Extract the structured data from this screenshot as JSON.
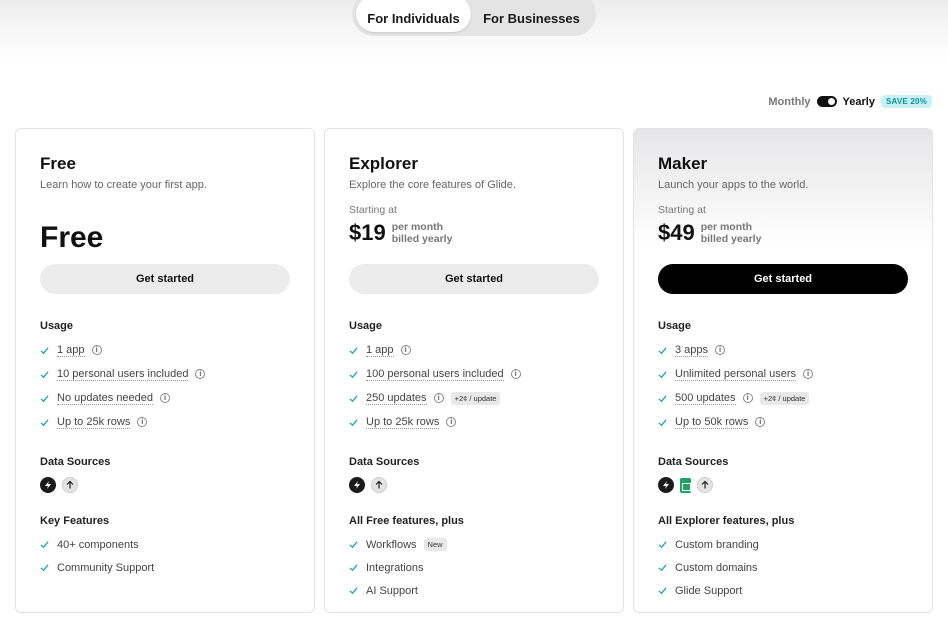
{
  "audience_tabs": [
    {
      "label": "For Individuals",
      "active": true
    },
    {
      "label": "For Businesses",
      "active": false
    }
  ],
  "billing": {
    "monthly_label": "Monthly",
    "yearly_label": "Yearly",
    "selected": "Yearly",
    "save_badge": "SAVE 20%"
  },
  "colors": {
    "accent": "#17a7b5",
    "badge_bg": "#c8f1f4",
    "dark_button": "#000000"
  },
  "plans": [
    {
      "name": "Free",
      "description": "Learn how to create your first app.",
      "price_display": "Free",
      "cta": "Get started",
      "usage_title": "Usage",
      "usage": [
        {
          "text": "1 app",
          "info": true
        },
        {
          "text": "10 personal users included",
          "info": true
        },
        {
          "text": "No updates needed",
          "info": true
        },
        {
          "text": "Up to 25k rows",
          "info": true
        }
      ],
      "sources_title": "Data Sources",
      "sources": [
        "glide-icon",
        "upload-icon"
      ],
      "features_title": "Key Features",
      "features": [
        "40+ components",
        "Community Support"
      ]
    },
    {
      "name": "Explorer",
      "description": "Explore the core features of Glide.",
      "starting_label": "Starting at",
      "price": "$19",
      "period_line1": "per month",
      "period_line2": "billed yearly",
      "cta": "Get started",
      "usage_title": "Usage",
      "usage": [
        {
          "text": "1 app",
          "info": true
        },
        {
          "text": "100 personal users included",
          "info": true
        },
        {
          "text": "250 updates",
          "info": true,
          "tag": "+2¢ / update"
        },
        {
          "text": "Up to 25k rows",
          "info": true
        }
      ],
      "sources_title": "Data Sources",
      "sources": [
        "glide-icon",
        "upload-icon"
      ],
      "features_title": "All Free features, plus",
      "features": [
        {
          "text": "Workflows",
          "tag": "New"
        },
        {
          "text": "Integrations"
        },
        {
          "text": "AI Support"
        }
      ]
    },
    {
      "name": "Maker",
      "description": "Launch your apps to the world.",
      "starting_label": "Starting at",
      "price": "$49",
      "period_line1": "per month",
      "period_line2": "billed yearly",
      "cta": "Get started",
      "usage_title": "Usage",
      "usage": [
        {
          "text": "3 apps",
          "info": true
        },
        {
          "text": "Unlimited personal users",
          "info": true
        },
        {
          "text": "500 updates",
          "info": true,
          "tag": "+2¢ / update"
        },
        {
          "text": "Up to 50k rows",
          "info": true
        }
      ],
      "sources_title": "Data Sources",
      "sources": [
        "glide-icon",
        "google-sheets-icon",
        "upload-icon"
      ],
      "features_title": "All Explorer features, plus",
      "features": [
        "Custom branding",
        "Custom domains",
        "Glide Support"
      ]
    }
  ]
}
